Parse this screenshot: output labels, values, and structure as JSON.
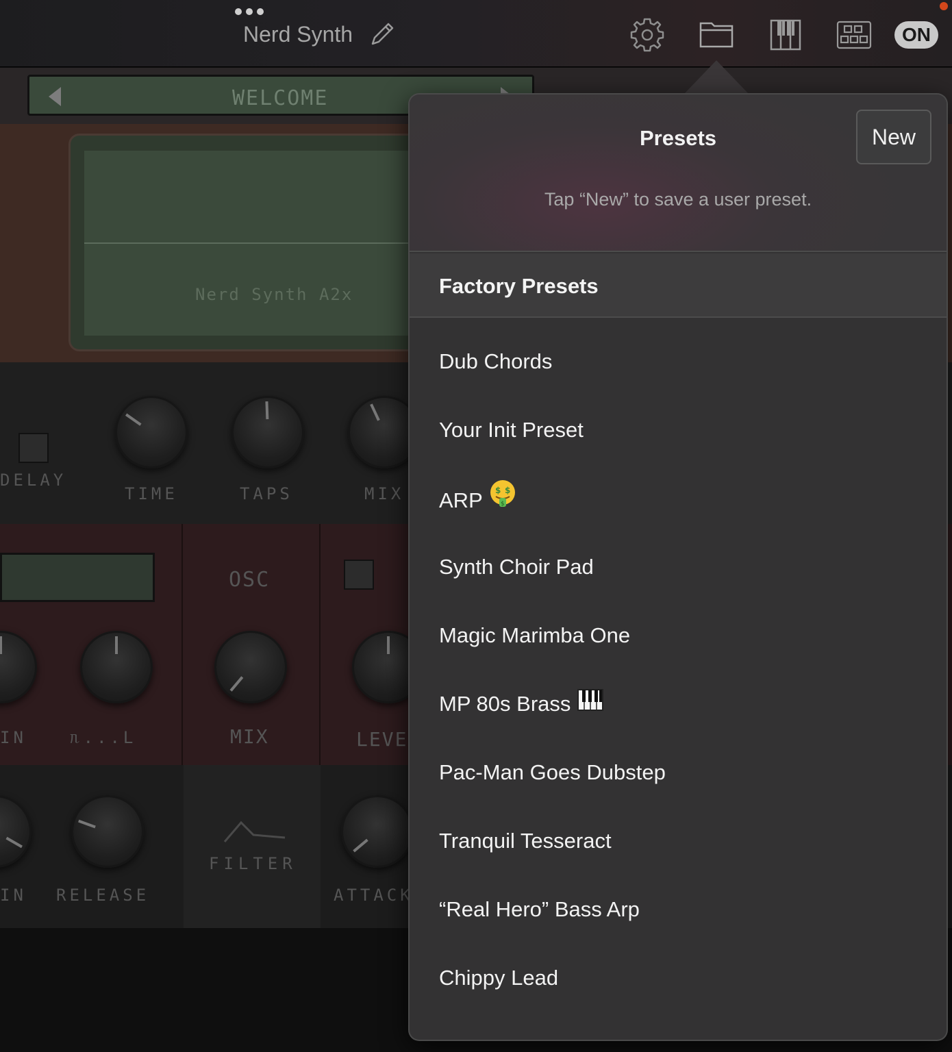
{
  "topbar": {
    "title": "Nerd Synth",
    "on_label": "ON",
    "icons": [
      "more-dots-icon",
      "pencil-icon",
      "gear-icon",
      "folder-icon",
      "piano-keys-icon",
      "grid-icon"
    ]
  },
  "synth": {
    "display_name": "WELCOME",
    "screen_text": "Nerd Synth A2x",
    "labels": {
      "delay": "DELAY",
      "time": "TIME",
      "taps": "TAPS",
      "mix_top": "MIX",
      "osc": "OSC",
      "mix_mid": "MIX",
      "level": "LEVEL",
      "gain_mid": "IN",
      "wave": "ᥰ...ᒪ",
      "release": "RELEASE",
      "filter": "FILTER",
      "attack": "ATTACK",
      "gain_bottom": "IN"
    }
  },
  "presets": {
    "title": "Presets",
    "new_label": "New",
    "hint": "Tap “New” to save a user preset.",
    "section_title": "Factory Presets",
    "items": [
      {
        "label": "Dub Chords"
      },
      {
        "label": "Your Init Preset"
      },
      {
        "label": "ARP",
        "emoji": "money-mouth-face-icon"
      },
      {
        "label": "Synth Choir Pad"
      },
      {
        "label": "Magic Marimba One"
      },
      {
        "label": "MP 80s Brass",
        "emoji": "piano-keys-icon"
      },
      {
        "label": "Pac-Man Goes Dubstep"
      },
      {
        "label": "Tranquil Tesseract"
      },
      {
        "label": "“Real Hero” Bass Arp"
      },
      {
        "label": "Chippy Lead"
      }
    ]
  },
  "colors": {
    "accent_record": "#d3471b",
    "popover_bg": "#333233",
    "text_primary": "#f3f3f3",
    "text_secondary": "#a9a9a9"
  }
}
